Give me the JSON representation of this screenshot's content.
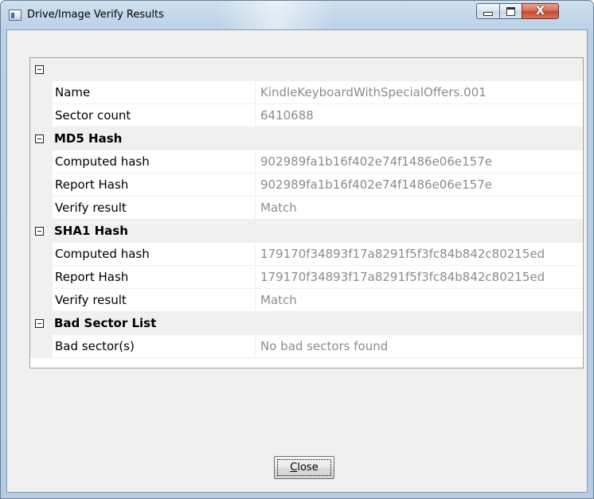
{
  "window": {
    "title": "Drive/Image Verify Results",
    "close_glyph": "X"
  },
  "properties": {
    "root_toggle": "⊟",
    "rows": [
      {
        "kind": "root"
      },
      {
        "kind": "prop",
        "name": "Name",
        "value": "KindleKeyboardWithSpecialOffers.001"
      },
      {
        "kind": "prop",
        "name": "Sector count",
        "value": "6410688"
      },
      {
        "kind": "cat",
        "name": "MD5 Hash"
      },
      {
        "kind": "prop",
        "name": "Computed hash",
        "value": "902989fa1b16f402e74f1486e06e157e"
      },
      {
        "kind": "prop",
        "name": "Report Hash",
        "value": "902989fa1b16f402e74f1486e06e157e"
      },
      {
        "kind": "prop",
        "name": "Verify result",
        "value": "Match"
      },
      {
        "kind": "cat",
        "name": "SHA1 Hash"
      },
      {
        "kind": "prop",
        "name": "Computed hash",
        "value": "179170f34893f17a8291f5f3fc84b842c80215ed"
      },
      {
        "kind": "prop",
        "name": "Report Hash",
        "value": "179170f34893f17a8291f5f3fc84b842c80215ed"
      },
      {
        "kind": "prop",
        "name": "Verify result",
        "value": "Match"
      },
      {
        "kind": "cat",
        "name": "Bad Sector List"
      },
      {
        "kind": "prop",
        "name": "Bad sector(s)",
        "value": "No bad sectors found"
      }
    ]
  },
  "buttons": {
    "close_label": "Close",
    "close_mnemonic": "C"
  },
  "icons": {
    "app": "app-window-icon",
    "minimize": "minimize-icon",
    "maximize": "maximize-icon",
    "close": "close-icon",
    "collapse": "collapse-toggle-icon"
  }
}
